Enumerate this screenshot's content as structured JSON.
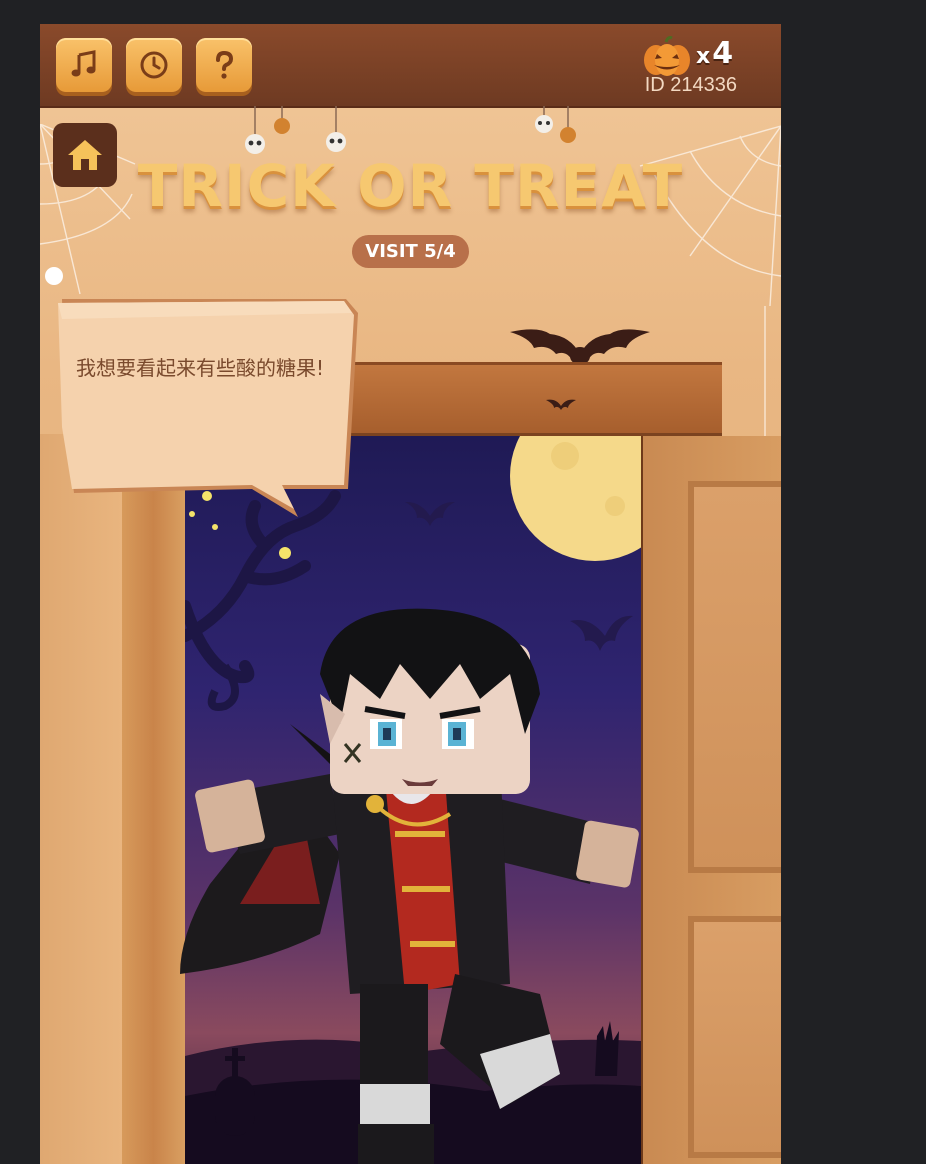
{
  "topbar": {
    "buttons": [
      {
        "name": "music",
        "icon": "music-note-icon"
      },
      {
        "name": "history",
        "icon": "clock-icon"
      },
      {
        "name": "help",
        "icon": "question-mark-icon"
      }
    ],
    "pumpkin_icon": "jack-o-lantern-icon",
    "multiplier_symbol": "x",
    "pumpkin_count": "4",
    "user_id": "ID 214336"
  },
  "home_icon": "home-icon",
  "title": "TRICK OR TREAT",
  "visit_badge": "VISIT 5/4",
  "speech_bubble": {
    "text": "我想要看起来有些酸的糖果!"
  },
  "colors": {
    "topbar": "#7a4126",
    "button_orange": "#f0ac4d",
    "title_gold": "#f6c870",
    "visit_pill": "#b8704a",
    "night_sky": "#2f2470",
    "moon": "#f5d98a"
  }
}
